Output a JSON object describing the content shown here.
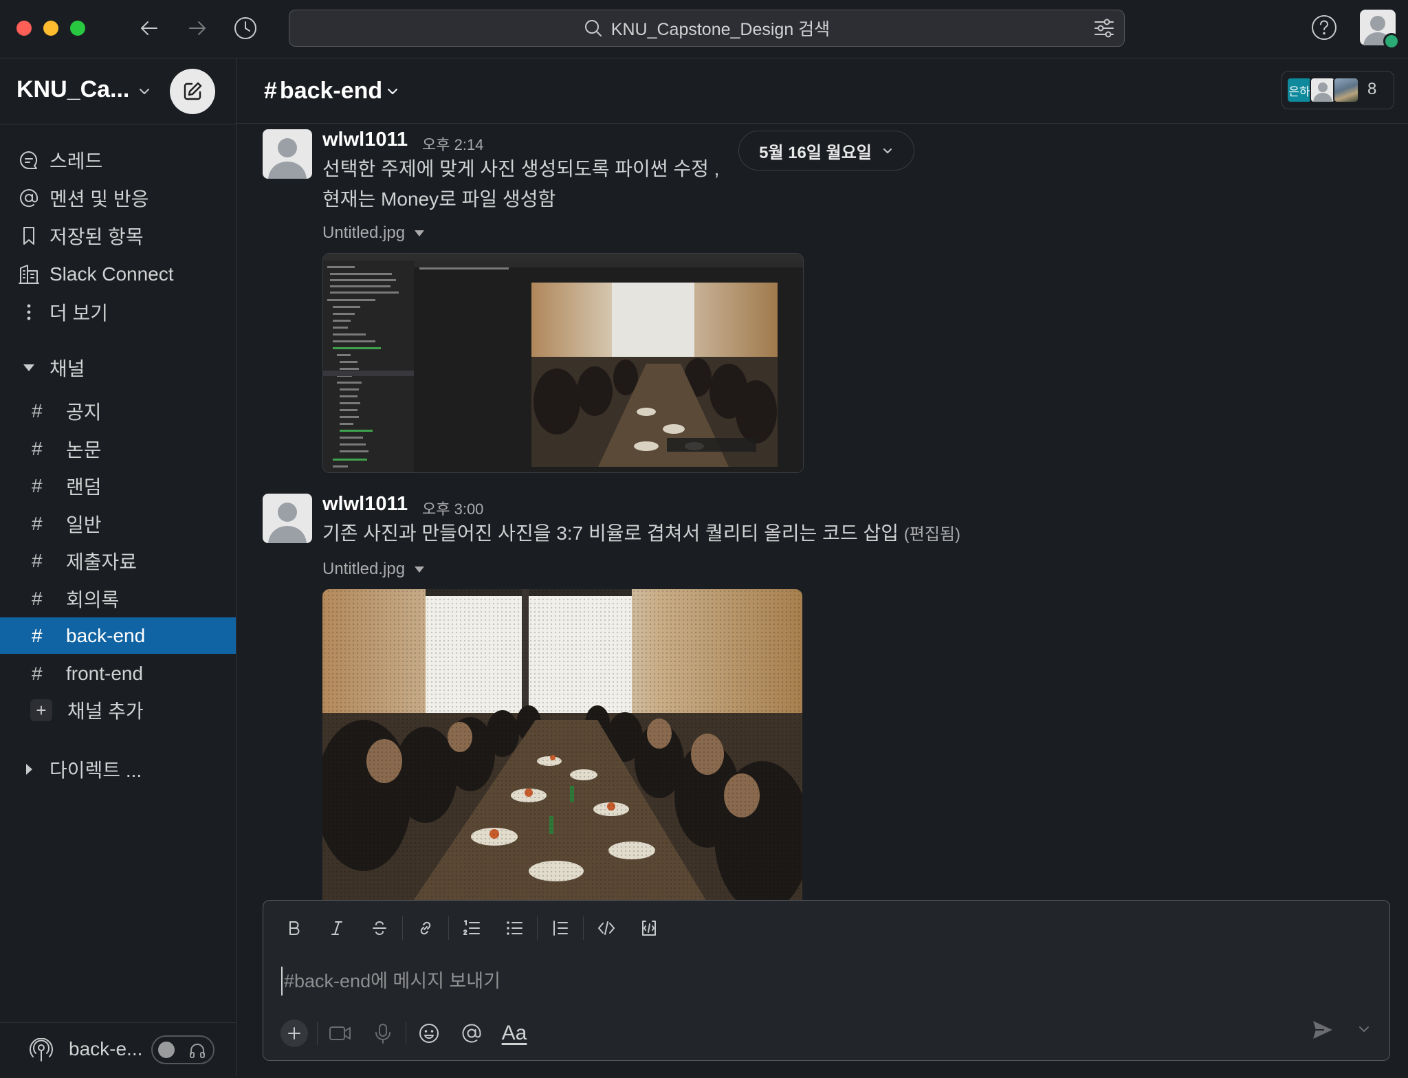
{
  "search": {
    "placeholder": "KNU_Capstone_Design 검색"
  },
  "workspace": {
    "name": "KNU_Ca..."
  },
  "nav": [
    {
      "label": "스레드",
      "icon": "threads-icon"
    },
    {
      "label": "멘션 및 반응",
      "icon": "at-icon"
    },
    {
      "label": "저장된 항목",
      "icon": "bookmark-icon"
    },
    {
      "label": "Slack Connect",
      "icon": "building-icon"
    },
    {
      "label": "더 보기",
      "icon": "more-icon"
    }
  ],
  "channels_section": {
    "label": "채널"
  },
  "channels": [
    {
      "label": "공지",
      "active": false
    },
    {
      "label": "논문",
      "active": false
    },
    {
      "label": "랜덤",
      "active": false
    },
    {
      "label": "일반",
      "active": false
    },
    {
      "label": "제출자료",
      "active": false
    },
    {
      "label": "회의록",
      "active": false
    },
    {
      "label": "back-end",
      "active": true
    },
    {
      "label": "front-end",
      "active": false
    }
  ],
  "add_channel": {
    "label": "채널 추가"
  },
  "dm_section": {
    "label": "다이렉트 ..."
  },
  "huddle": {
    "label": "back-e..."
  },
  "channel": {
    "hash": "#",
    "name": "back-end",
    "member_count": "8",
    "member_badge": "은하"
  },
  "date_divider": {
    "label": "5월 16일 월요일"
  },
  "messages": [
    {
      "user": "wlwl1011",
      "time": "오후 2:14",
      "lines": [
        "선택한 주제에 맞게 사진 생성되도록 파이썬 수정 ,",
        "현재는 Money로 파일 생성함"
      ],
      "file": "Untitled.jpg"
    },
    {
      "user": "wlwl1011",
      "time": "오후 3:00",
      "lines": [
        "기존 사진과 만들어진 사진을 3:7 비율로 겹쳐서 퀄리티 올리는 코드 삽입"
      ],
      "edited": "(편집됨)",
      "file": "Untitled.jpg"
    }
  ],
  "composer": {
    "placeholder": "#back-end에 메시지 보내기",
    "value": "",
    "aa_label": "Aa"
  },
  "colors": {
    "accent": "#1164a3",
    "background": "#1a1d21",
    "presence": "#2bac76"
  }
}
